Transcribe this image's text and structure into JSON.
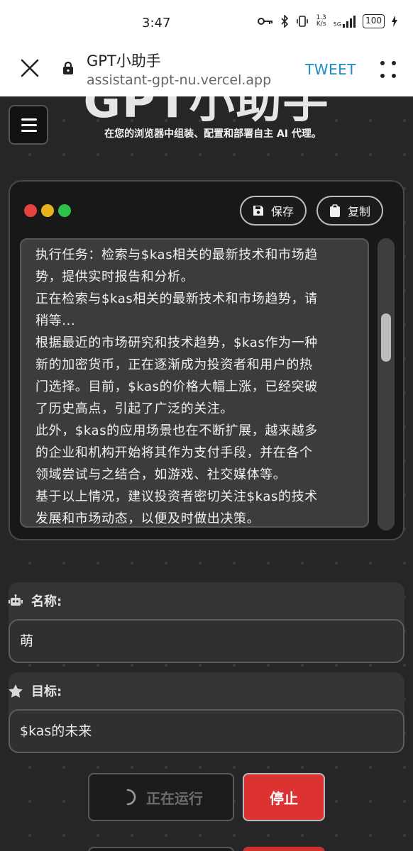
{
  "status_bar": {
    "time": "3:47",
    "net_speed_top": "1.3",
    "net_speed_bottom": "K/s",
    "signal_label": "5G",
    "battery": "100"
  },
  "browser": {
    "title": "GPT小助手",
    "url": "assistant-gpt-nu.vercel.app",
    "tweet_label": "TWEET"
  },
  "app": {
    "hero_title": "GPT小助手",
    "hero_subtitle": "在您的浏览器中组装、配置和部署自主 AI 代理。",
    "toolbar": {
      "save_label": "保存",
      "copy_label": "复制"
    },
    "log_lines": [
      "执行任务：检索与$kas相关的最新技术和市场趋",
      "势，提供实时报告和分析。",
      "正在检索与$kas相关的最新技术和市场趋势，请",
      "稍等...",
      "根据最近的市场研究和技术趋势，$kas作为一种",
      "新的加密货币，正在逐渐成为投资者和用户的热",
      "门选择。目前，$kas的价格大幅上涨，已经突破",
      "了历史高点，引起了广泛的关注。",
      "此外，$kas的应用场景也在不断扩展，越来越多",
      "的企业和机构开始将其作为支付手段，并在各个",
      "领域尝试与之结合，如游戏、社交媒体等。",
      "基于以上情况，建议投资者密切关注$kas的技术",
      "发展和市场动态，以便及时做出决策。"
    ],
    "name_field": {
      "label": "名称:",
      "value": "萌"
    },
    "goal_field": {
      "label": "目标:",
      "value": "$kas的未来"
    },
    "running_label": "正在运行",
    "stop_label": "停止",
    "colors": {
      "dot_red": "#e5443e",
      "dot_yellow": "#e8b21d",
      "dot_green": "#2fc24b",
      "stop_red": "#dc3232",
      "tweet_blue": "#1a8ccd"
    }
  }
}
